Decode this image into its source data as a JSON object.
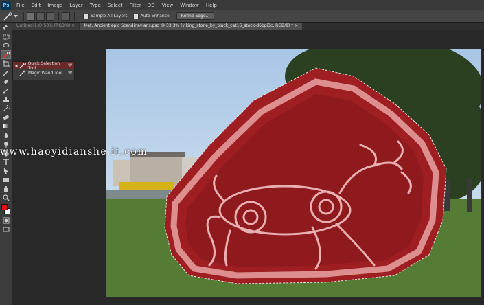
{
  "app": {
    "logo": "Ps"
  },
  "menu": [
    "File",
    "Edit",
    "Image",
    "Layer",
    "Type",
    "Select",
    "Filter",
    "3D",
    "View",
    "Window",
    "Help"
  ],
  "options": {
    "sample_all_layers": "Sample All Layers",
    "auto_enhance": "Auto-Enhance",
    "refine_edge": "Refine Edge..."
  },
  "tabs": [
    {
      "label": "Untitled-1 @ 50% (RGB/8)",
      "close": "×"
    },
    {
      "label": "Met. Ancient epic Scandinavians.psd @ 33.3% (viking_stone_by_black_cat16_stock-d6bpi3c, RGB/8) *",
      "close": "×"
    }
  ],
  "flyout": [
    {
      "bullet": "▪",
      "label": "Quick Selection Tool",
      "shortcut": "W"
    },
    {
      "bullet": "",
      "label": "Magic Wand Tool",
      "shortcut": "W"
    }
  ],
  "watermark": "www.haoyidianshe.it.com",
  "colors": {
    "foreground": "#e01010",
    "background": "#ffffff",
    "selection_overlay": "#a01a1a"
  },
  "icons": [
    "move-icon",
    "marquee-icon",
    "lasso-icon",
    "quick-selection-icon",
    "crop-icon",
    "eyedropper-icon",
    "healing-brush-icon",
    "brush-icon",
    "clone-stamp-icon",
    "history-brush-icon",
    "eraser-icon",
    "gradient-icon",
    "blur-icon",
    "dodge-icon",
    "pen-icon",
    "type-icon",
    "path-selection-icon",
    "shape-icon",
    "hand-icon",
    "zoom-icon"
  ]
}
